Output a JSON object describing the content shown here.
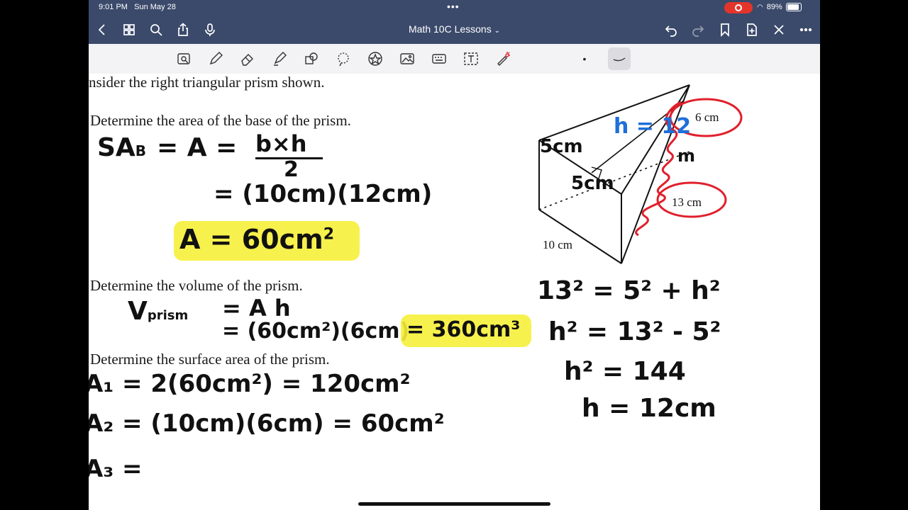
{
  "status": {
    "time": "9:01 PM",
    "date": "Sun May 28",
    "battery": "89%"
  },
  "nav": {
    "title": "Math 10C Lessons",
    "title_chevron": "⌄"
  },
  "toolbar": {
    "pen_dot": "•"
  },
  "problem": {
    "intro": "nsider the right triangular prism shown.",
    "q_a": "Determine the area of the base of the prism.",
    "q_b": "Determine the volume of the prism.",
    "q_c": "Determine the surface area of the prism."
  },
  "work": {
    "sab": "SA",
    "sab_sub": "B",
    "eq_a1": "= A =",
    "frac_num": "b×h",
    "frac_den": "2",
    "eq_a2": "= (10cm)(12cm)",
    "result_a": "A = 60cm",
    "result_a_sup": "2",
    "vol_label": "V",
    "vol_sub": "prism",
    "vol_eq1": "= A h",
    "vol_eq2": "= (60cm²)(6cm)",
    "vol_result": "= 360cm³",
    "a1": "A₁ = 2(60cm²) = 120cm²",
    "a2": "A₂ = (10cm)(6cm) = 60cm²",
    "a3": "A₃ ="
  },
  "diagram": {
    "label_6cm": "6 cm",
    "label_13cm": "13 cm",
    "label_10cm": "10 cm",
    "hand_5cm": "5cm",
    "hand_5cm_b": "5cm",
    "hand_h": "h = 12",
    "hand_m": "m"
  },
  "pythag": {
    "l1": "13² = 5² + h²",
    "l2": "h² = 13² - 5²",
    "l3": "h² = 144",
    "l4": "h = 12cm"
  },
  "colors": {
    "nav": "#3b4a6b",
    "highlight": "#f6ef3a",
    "red_ink": "#e0202c",
    "blue_ink": "#1f6fd8"
  }
}
